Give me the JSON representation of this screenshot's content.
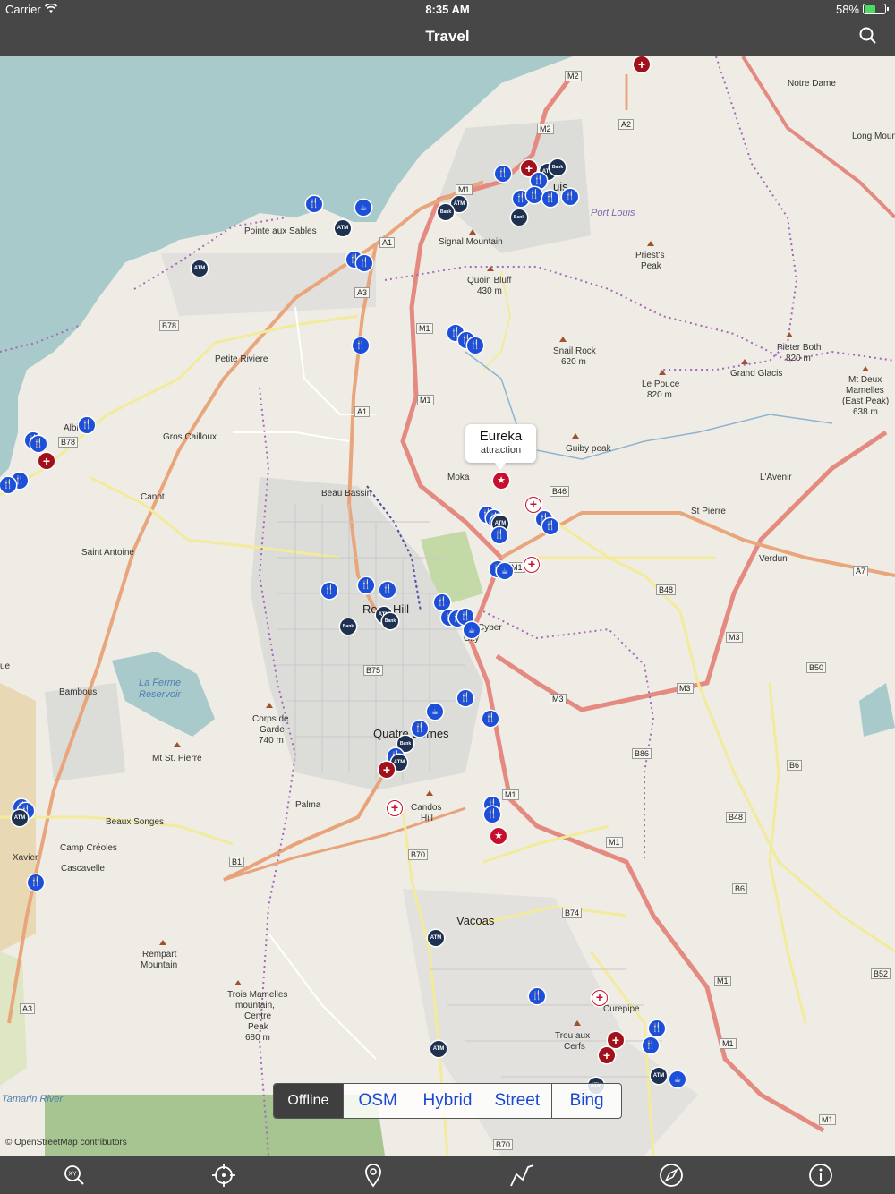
{
  "status_bar": {
    "carrier": "Carrier",
    "time": "8:35 AM",
    "battery": "58%",
    "battery_level": 0.58
  },
  "nav": {
    "title": "Travel",
    "search_icon": "search-icon"
  },
  "map": {
    "callout": {
      "title": "Eureka",
      "subtitle": "attraction"
    },
    "attribution": "© OpenStreetMap contributors",
    "places": [
      {
        "id": "notre-dame",
        "text": "Notre Dame"
      },
      {
        "id": "long-mountain",
        "text": "Long Moun"
      },
      {
        "id": "port-louis-city",
        "text": "Port Louis"
      },
      {
        "id": "port-louis-cut",
        "text": "uis"
      },
      {
        "id": "pointe-aux-sables",
        "text": "Pointe aux Sables"
      },
      {
        "id": "signal-mountain",
        "text": "Signal Mountain"
      },
      {
        "id": "quoin-bluff",
        "text": "Quoin Bluff"
      },
      {
        "id": "quoin-bluff-ele",
        "text": "430 m"
      },
      {
        "id": "priests-peak",
        "text": "Priest's"
      },
      {
        "id": "priests-peak-2",
        "text": "Peak"
      },
      {
        "id": "petite-riviere",
        "text": "Petite Riviere"
      },
      {
        "id": "snail-rock",
        "text": "Snail Rock"
      },
      {
        "id": "snail-rock-ele",
        "text": "620 m"
      },
      {
        "id": "pieter-both",
        "text": "Pieter Both"
      },
      {
        "id": "pieter-both-ele",
        "text": "820 m"
      },
      {
        "id": "grand-glacis",
        "text": "Grand Glacis"
      },
      {
        "id": "le-pouce",
        "text": "Le Pouce"
      },
      {
        "id": "le-pouce-ele",
        "text": "820 m"
      },
      {
        "id": "mt-deux",
        "text": "Mt Deux"
      },
      {
        "id": "mt-deux-2",
        "text": "Mamelles"
      },
      {
        "id": "mt-deux-3",
        "text": "(East Peak)"
      },
      {
        "id": "mt-deux-ele",
        "text": "638 m"
      },
      {
        "id": "albion",
        "text": "Albi"
      },
      {
        "id": "gros-cailloux",
        "text": "Gros Cailloux"
      },
      {
        "id": "guiby-peak",
        "text": "Guiby peak"
      },
      {
        "id": "moka",
        "text": "Moka"
      },
      {
        "id": "lavenir",
        "text": "L'Avenir"
      },
      {
        "id": "canot",
        "text": "Canot"
      },
      {
        "id": "beau-bassin",
        "text": "Beau Bassin"
      },
      {
        "id": "st-pierre",
        "text": "St Pierre"
      },
      {
        "id": "saint-antoine",
        "text": "Saint Antoine"
      },
      {
        "id": "verdun",
        "text": "Verdun"
      },
      {
        "id": "rose-hill",
        "text": "Rose Hill"
      },
      {
        "id": "ebene",
        "text": "Cyber"
      },
      {
        "id": "ebene-2",
        "text": "City"
      },
      {
        "id": "la-ferme",
        "text": "La Ferme"
      },
      {
        "id": "la-ferme-2",
        "text": "Reservoir"
      },
      {
        "id": "bambous",
        "text": "Bambous"
      },
      {
        "id": "corps-de-garde",
        "text": "Corps de"
      },
      {
        "id": "corps-de-garde-2",
        "text": "Garde"
      },
      {
        "id": "corps-de-garde-ele",
        "text": "740 m"
      },
      {
        "id": "quatre-bornes",
        "text": "Quatre Bornes"
      },
      {
        "id": "mt-st-pierre",
        "text": "Mt St. Pierre"
      },
      {
        "id": "ue",
        "text": "ue"
      },
      {
        "id": "palma",
        "text": "Palma"
      },
      {
        "id": "candos-hill",
        "text": "Candos"
      },
      {
        "id": "candos-hill-2",
        "text": "Hill"
      },
      {
        "id": "beaux-songes",
        "text": "Beaux Songes"
      },
      {
        "id": "camp-creoles",
        "text": "Camp Créoles"
      },
      {
        "id": "xavier",
        "text": "Xavier"
      },
      {
        "id": "cascavelle",
        "text": "Cascavelle"
      },
      {
        "id": "vacoas",
        "text": "Vacoas"
      },
      {
        "id": "rempart",
        "text": "Rempart"
      },
      {
        "id": "rempart-2",
        "text": "Mountain"
      },
      {
        "id": "trois-mamelles",
        "text": "Trois Mamelles"
      },
      {
        "id": "trois-mamelles-2",
        "text": "mountain,"
      },
      {
        "id": "trois-mamelles-3",
        "text": "Centre"
      },
      {
        "id": "trois-mamelles-4",
        "text": "Peak"
      },
      {
        "id": "trois-mamelles-ele",
        "text": "680 m"
      },
      {
        "id": "curepipe",
        "text": "Curepipe"
      },
      {
        "id": "trou-aux-cerfs",
        "text": "Trou aux"
      },
      {
        "id": "trou-aux-cerfs-2",
        "text": "Cerfs"
      },
      {
        "id": "tamarin-river",
        "text": "Tamarin River"
      }
    ],
    "road_shields": [
      "M2",
      "M2",
      "A2",
      "M1",
      "A1",
      "A3",
      "B78",
      "M1",
      "M1",
      "A1",
      "B78",
      "B46",
      "M1",
      "A7",
      "B48",
      "M3",
      "B50",
      "M3",
      "M3",
      "B75",
      "B86",
      "B6",
      "M1",
      "B48",
      "M1",
      "B1",
      "B70",
      "B74",
      "M1",
      "B6",
      "B52",
      "M1",
      "A3",
      "M1",
      "B70",
      "B70"
    ],
    "poi_types": {
      "food": "🍴",
      "atm": "ATM",
      "bank": "Bank",
      "hospital": "+",
      "attraction": "★",
      "cafe": "☕"
    }
  },
  "segmented": {
    "options": [
      "Offline",
      "OSM",
      "Hybrid",
      "Street",
      "Bing"
    ],
    "selected": "Offline"
  },
  "toolbar": {
    "items": [
      {
        "name": "coordinate-search-icon"
      },
      {
        "name": "locate-me-icon"
      },
      {
        "name": "place-marker-icon"
      },
      {
        "name": "route-icon"
      },
      {
        "name": "compass-icon"
      },
      {
        "name": "info-icon"
      }
    ]
  }
}
